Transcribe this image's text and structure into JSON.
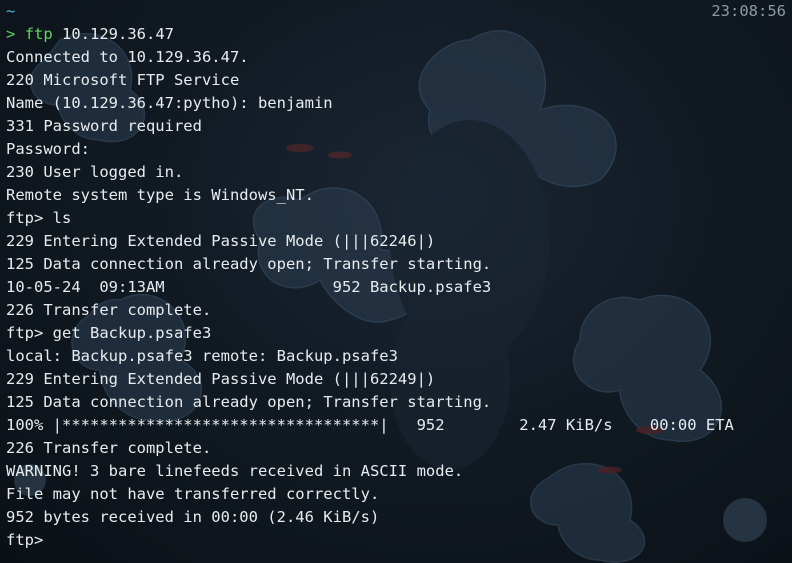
{
  "header": {
    "cwd": "~",
    "time": "23:08:56"
  },
  "prompt": {
    "symbol": ">",
    "command": "ftp",
    "args": " 10.129.36.47"
  },
  "output": [
    "Connected to 10.129.36.47.",
    "220 Microsoft FTP Service",
    "Name (10.129.36.47:pytho): benjamin",
    "331 Password required",
    "Password:",
    "230 User logged in.",
    "Remote system type is Windows_NT.",
    "ftp> ls",
    "229 Entering Extended Passive Mode (|||62246|)",
    "125 Data connection already open; Transfer starting.",
    "10-05-24  09:13AM                  952 Backup.psafe3",
    "226 Transfer complete.",
    "ftp> get Backup.psafe3",
    "local: Backup.psafe3 remote: Backup.psafe3",
    "229 Entering Extended Passive Mode (|||62249|)",
    "125 Data connection already open; Transfer starting.",
    "100% |**********************************|   952        2.47 KiB/s    00:00 ETA",
    "226 Transfer complete.",
    "WARNING! 3 bare linefeeds received in ASCII mode.",
    "File may not have transferred correctly.",
    "952 bytes received in 00:00 (2.46 KiB/s)",
    "ftp>"
  ],
  "colors": {
    "prompt": "#5fd35f",
    "cwd": "#4fb3d9",
    "text": "#e8ecef",
    "clock": "#8a9aa6"
  }
}
